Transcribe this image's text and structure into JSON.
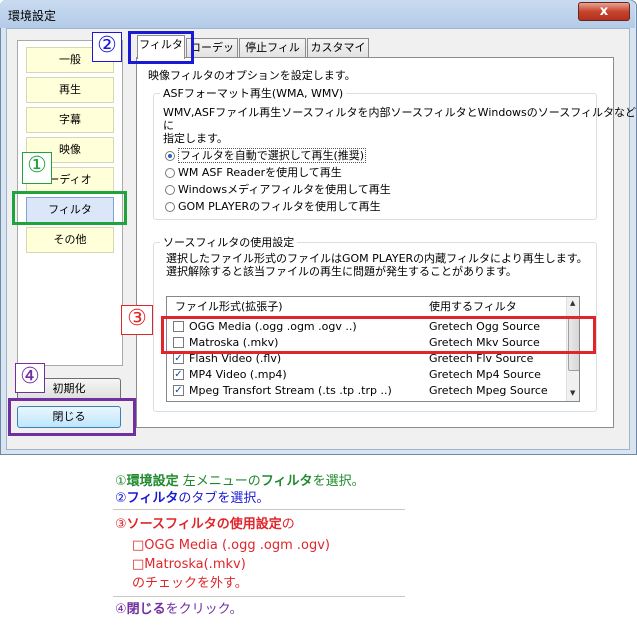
{
  "window": {
    "title": "環境設定",
    "close_glyph": "x"
  },
  "menu": {
    "items": [
      "一般",
      "再生",
      "字幕",
      "映像",
      "ーディオ",
      "フィルタ",
      "その他"
    ],
    "selected": "フィルタ"
  },
  "tabs": [
    "フィルタ",
    "コーデック",
    "停止フィルタ",
    "カスタマイズ"
  ],
  "page": {
    "description": "映像フィルタのオプションを設定します。",
    "asf_group": {
      "legend": "ASFフォーマット再生(WMA, WMV)",
      "text1": "WMV,ASFファイル再生ソースフィルタを内部ソースフィルタとWindowsのソースフィルタなどに",
      "text2": "指定します。",
      "options": [
        "フィルタを自動で選択して再生(推奨)",
        "WM ASF Readerを使用して再生",
        "Windowsメディアフィルタを使用して再生",
        "GOM PLAYERのフィルタを使用して再生"
      ],
      "selected_index": 0
    },
    "source_group": {
      "legend": "ソースフィルタの使用設定",
      "text1": "選択したファイル形式のファイルはGOM PLAYERの内蔵フィルタにより再生します。",
      "text2": "選択解除すると該当ファイルの再生に問題が発生することがあります。"
    },
    "list": {
      "headers": [
        "ファイル形式(拡張子)",
        "使用するフィルタ"
      ],
      "rows": [
        {
          "format": "OGG Media (.ogg .ogm .ogv ..)",
          "filter": "Gretech Ogg Source",
          "checked": false
        },
        {
          "format": "Matroska (.mkv)",
          "filter": "Gretech Mkv Source",
          "checked": false
        },
        {
          "format": "Flash Video (.flv)",
          "filter": "Gretech Flv Source",
          "checked": true
        },
        {
          "format": "MP4 Video (.mp4)",
          "filter": "Gretech Mp4 Source",
          "checked": true
        },
        {
          "format": "Mpeg Transfort Stream (.ts .tp .trp ..)",
          "filter": "Gretech Mpeg Source",
          "checked": true
        }
      ]
    }
  },
  "buttons": {
    "reset": "初期化",
    "close": "閉じる"
  },
  "annotations": {
    "n1": "①",
    "n2": "②",
    "n3": "③",
    "n4": "④",
    "green": "#1fa33a",
    "blue": "#1a1ad4",
    "red": "#e0262a",
    "purple": "#7030a0"
  },
  "notes": {
    "line1_a": "①",
    "line1_b": "環境設定",
    "line1_c": " 左メニューの",
    "line1_d": "フィルタ",
    "line1_e": "を選択。",
    "line2_a": "②",
    "line2_b": "フィルタ",
    "line2_c": "のタブを選択。",
    "line3_a": "③",
    "line3_b": "ソースフィルタの使用設定",
    "line3_c": "の",
    "line4": "□OGG Media (.ogg .ogm .ogv)",
    "line5": "□Matroska(.mkv)",
    "line6": "のチェックを外す。",
    "line7_a": "④",
    "line7_b": "閉じる",
    "line7_c": "をクリック。"
  }
}
